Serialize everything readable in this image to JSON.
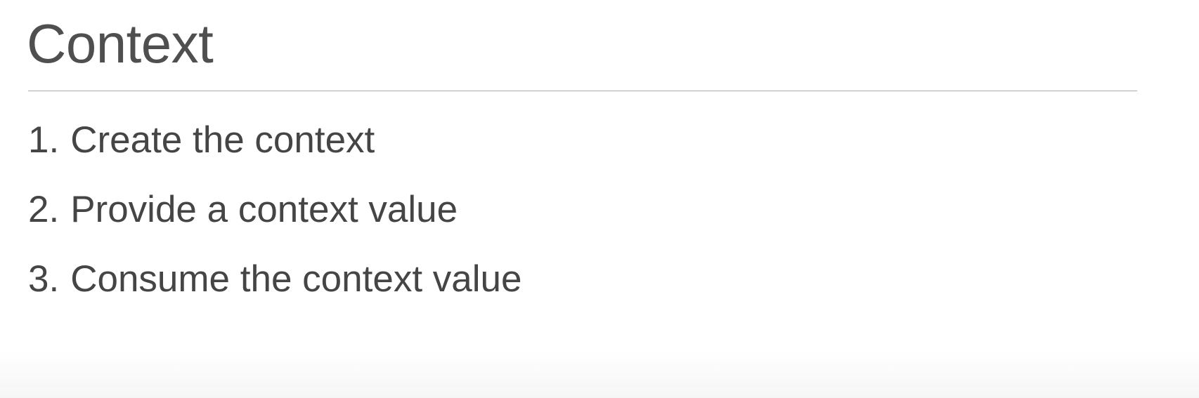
{
  "slide": {
    "title": "Context",
    "items": [
      {
        "number": "1.",
        "text": "Create the context"
      },
      {
        "number": "2.",
        "text": "Provide a context value"
      },
      {
        "number": "3.",
        "text": "Consume the context value"
      }
    ]
  },
  "colors": {
    "title_text": "#4f4f4f",
    "body_text": "#454545",
    "rule": "#a9a9a9",
    "background": "#ffffff"
  }
}
